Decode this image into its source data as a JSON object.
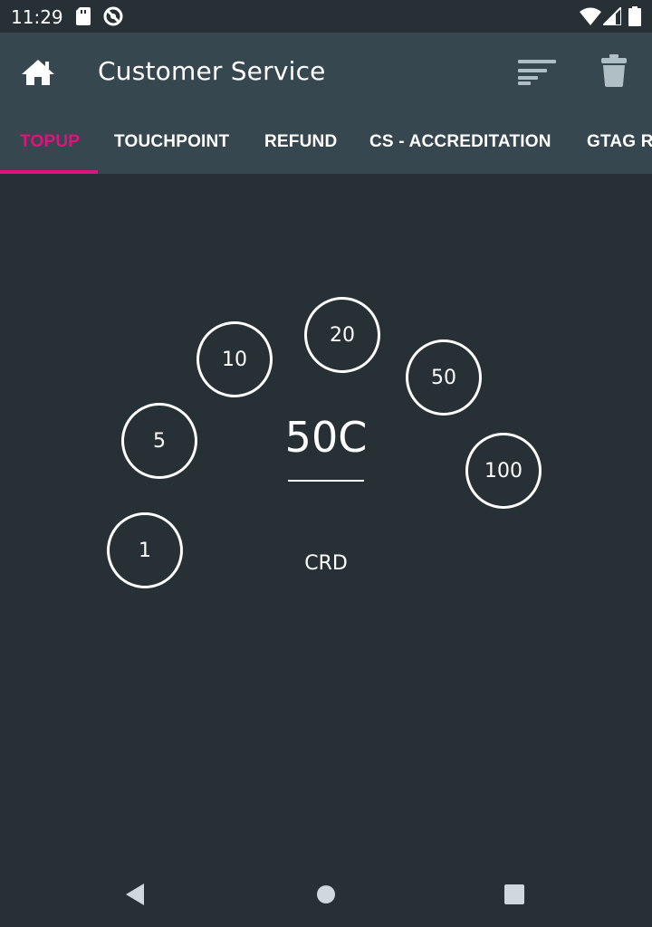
{
  "status_bar": {
    "time": "11:29",
    "icons": [
      "sd-card-icon",
      "do-not-disturb-icon",
      "wifi-icon",
      "signal-icon",
      "battery-icon"
    ]
  },
  "app_bar": {
    "title": "Customer Service",
    "icons": [
      "home-icon",
      "sort-icon",
      "trash-icon"
    ]
  },
  "tabs": [
    {
      "label": "TOPUP",
      "active": true
    },
    {
      "label": "TOUCHPOINT",
      "active": false
    },
    {
      "label": "REFUND",
      "active": false
    },
    {
      "label": "CS - ACCREDITATION",
      "active": false
    },
    {
      "label": "GTAG R",
      "active": false
    }
  ],
  "topup": {
    "chips": [
      "1",
      "5",
      "10",
      "20",
      "50",
      "100"
    ],
    "amount": "50C",
    "currency": "CRD"
  },
  "nav_bar": {
    "icons": [
      "back-icon",
      "home-circle-icon",
      "recents-icon"
    ]
  },
  "colors": {
    "background": "#263035",
    "app_bar": "#37474f",
    "accent": "#e0127d",
    "text": "#ffffff"
  }
}
